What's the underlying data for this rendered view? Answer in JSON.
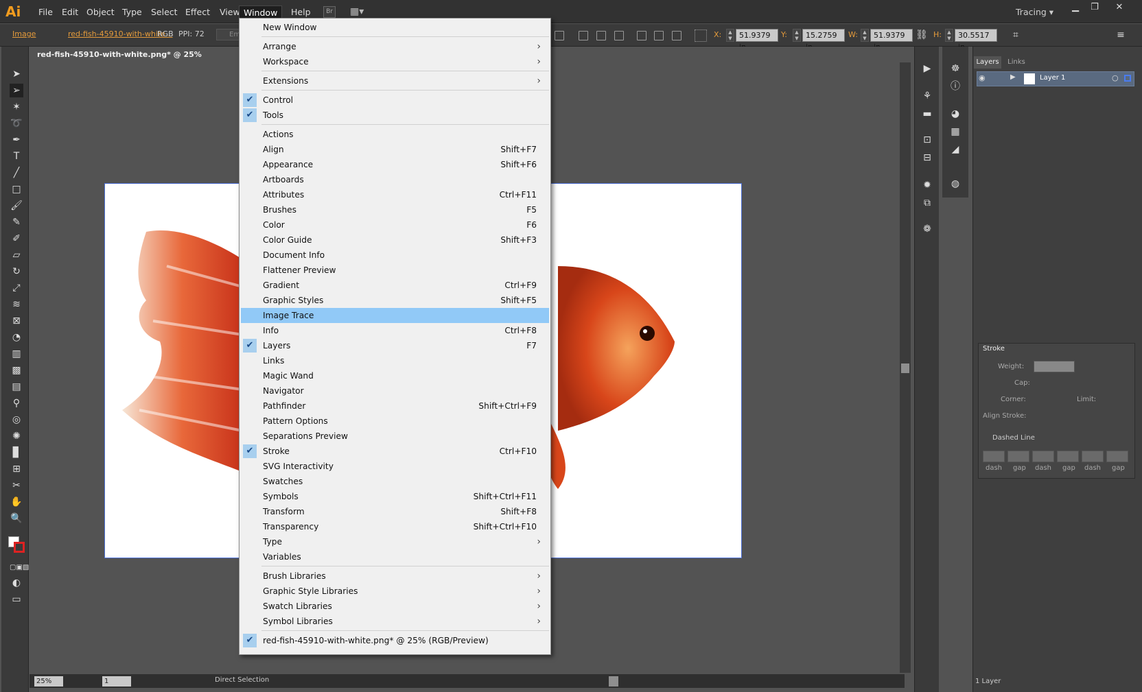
{
  "app": {
    "logo": "Ai"
  },
  "menubar": {
    "items": [
      "File",
      "Edit",
      "Object",
      "Type",
      "Select",
      "Effect",
      "View",
      "Window",
      "Help"
    ],
    "bridge": "Br",
    "workspace": "Tracing"
  },
  "control": {
    "kind": "Image",
    "file": "red-fish-45910-with-white...",
    "mode": "RGB",
    "ppi": "PPI: 72",
    "embed": "Em",
    "x_label": "X:",
    "x": "51.9379 in",
    "y_label": "Y:",
    "y": "15.2759 in",
    "w_label": "W:",
    "w": "51.9379 in",
    "h_label": "H:",
    "h": "30.5517 in"
  },
  "doc_tab": "red-fish-45910-with-white.png* @ 25% (RGB/Preview)",
  "status": {
    "zoom": "25%",
    "artboard": "1",
    "tool": "Direct Selection"
  },
  "layers_panel": {
    "tab_layers": "Layers",
    "tab_links": "Links",
    "layer_name": "Layer 1",
    "count": "1 Layer"
  },
  "stroke_panel": {
    "title": "Stroke",
    "weight": "Weight:",
    "cap": "Cap:",
    "corner": "Corner:",
    "limit": "Limit:",
    "align": "Align Stroke:",
    "dashed": "Dashed Line",
    "dash": "dash",
    "gap": "gap"
  },
  "window_menu": [
    {
      "label": "New Window"
    },
    {
      "sep": true
    },
    {
      "label": "Arrange",
      "submenu": true
    },
    {
      "label": "Workspace",
      "submenu": true
    },
    {
      "sep": true
    },
    {
      "label": "Extensions",
      "submenu": true
    },
    {
      "sep": true
    },
    {
      "label": "Control",
      "checked": true
    },
    {
      "label": "Tools",
      "checked": true
    },
    {
      "sep": true
    },
    {
      "label": "Actions"
    },
    {
      "label": "Align",
      "shortcut": "Shift+F7"
    },
    {
      "label": "Appearance",
      "shortcut": "Shift+F6"
    },
    {
      "label": "Artboards"
    },
    {
      "label": "Attributes",
      "shortcut": "Ctrl+F11"
    },
    {
      "label": "Brushes",
      "shortcut": "F5"
    },
    {
      "label": "Color",
      "shortcut": "F6"
    },
    {
      "label": "Color Guide",
      "shortcut": "Shift+F3"
    },
    {
      "label": "Document Info"
    },
    {
      "label": "Flattener Preview"
    },
    {
      "label": "Gradient",
      "shortcut": "Ctrl+F9"
    },
    {
      "label": "Graphic Styles",
      "shortcut": "Shift+F5"
    },
    {
      "label": "Image Trace",
      "highlighted": true
    },
    {
      "label": "Info",
      "shortcut": "Ctrl+F8"
    },
    {
      "label": "Layers",
      "shortcut": "F7",
      "checked": true
    },
    {
      "label": "Links"
    },
    {
      "label": "Magic Wand"
    },
    {
      "label": "Navigator"
    },
    {
      "label": "Pathfinder",
      "shortcut": "Shift+Ctrl+F9"
    },
    {
      "label": "Pattern Options"
    },
    {
      "label": "Separations Preview"
    },
    {
      "label": "Stroke",
      "shortcut": "Ctrl+F10",
      "checked": true
    },
    {
      "label": "SVG Interactivity"
    },
    {
      "label": "Swatches"
    },
    {
      "label": "Symbols",
      "shortcut": "Shift+Ctrl+F11"
    },
    {
      "label": "Transform",
      "shortcut": "Shift+F8"
    },
    {
      "label": "Transparency",
      "shortcut": "Shift+Ctrl+F10"
    },
    {
      "label": "Type",
      "submenu": true
    },
    {
      "label": "Variables"
    },
    {
      "sep": true
    },
    {
      "label": "Brush Libraries",
      "submenu": true
    },
    {
      "label": "Graphic Style Libraries",
      "submenu": true
    },
    {
      "label": "Swatch Libraries",
      "submenu": true
    },
    {
      "label": "Symbol Libraries",
      "submenu": true
    },
    {
      "sep": true
    },
    {
      "label": "red-fish-45910-with-white.png* @ 25% (RGB/Preview)",
      "checked": true
    }
  ],
  "colors": {
    "accent": "#e59b3b",
    "highlight": "#91c9f7",
    "check_bg": "#a8cfee",
    "fish": "#d8461a"
  }
}
